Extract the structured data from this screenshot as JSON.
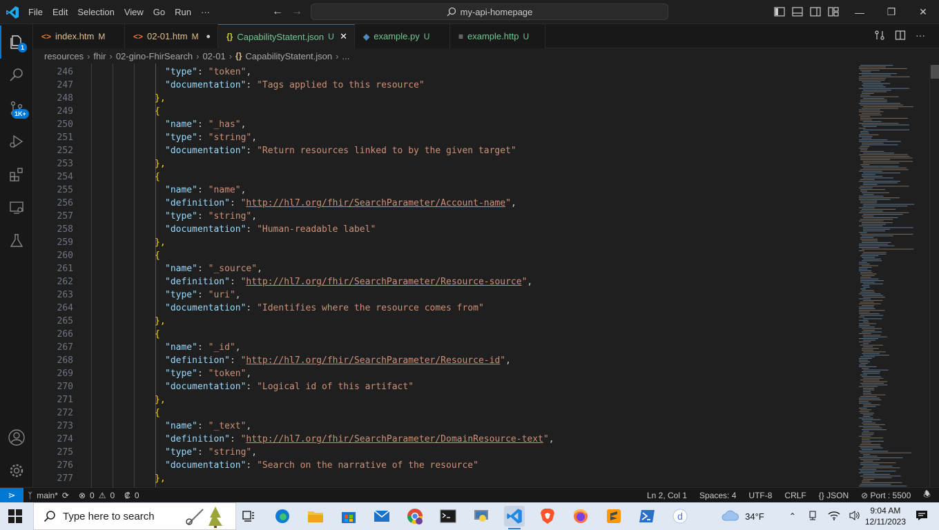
{
  "menu": [
    "File",
    "Edit",
    "Selection",
    "View",
    "Go",
    "Run",
    "···"
  ],
  "command_center": "my-api-homepage",
  "window_controls": {
    "minimize": "—",
    "restore": "❐",
    "close": "✕"
  },
  "activity_badges": {
    "accounts_badge": "1",
    "source_control_badge": "1K+"
  },
  "tabs": [
    {
      "label": "index.htm",
      "status": "M",
      "icon": "<>",
      "icon_color": "#e37933",
      "label_color": "#e2c08d",
      "status_color": "#e2c08d"
    },
    {
      "label": "02-01.htm",
      "status": "M",
      "icon": "<>",
      "icon_color": "#e37933",
      "label_color": "#e2c08d",
      "status_color": "#e2c08d",
      "dirty": "●"
    },
    {
      "label": "CapabilityStatent.json",
      "status": "U",
      "icon": "{}",
      "icon_color": "#cbcb41",
      "label_color": "#73c991",
      "status_color": "#73c991",
      "close": "✕"
    },
    {
      "label": "example.py",
      "status": "U",
      "icon": "◆",
      "icon_color": "#4b8bbe",
      "label_color": "#73c991",
      "status_color": "#73c991"
    },
    {
      "label": "example.http",
      "status": "U",
      "icon": "≡",
      "icon_color": "#cccccc",
      "label_color": "#73c991",
      "status_color": "#73c991"
    }
  ],
  "breadcrumb": [
    "resources",
    "fhir",
    "02-gino-FhirSearch",
    "02-01",
    "CapabilityStatent.json",
    "..."
  ],
  "breadcrumb_file_icon": "{}",
  "editor": {
    "lines": [
      {
        "num": "246",
        "key": "type",
        "val": "token",
        "comma": true
      },
      {
        "num": "247",
        "key": "documentation",
        "val": "Tags applied to this resource",
        "comma": false
      },
      {
        "num": "248",
        "punct": "},"
      },
      {
        "num": "249",
        "punct": "{"
      },
      {
        "num": "250",
        "key": "name",
        "val": "_has",
        "comma": true
      },
      {
        "num": "251",
        "key": "type",
        "val": "string",
        "comma": true
      },
      {
        "num": "252",
        "key": "documentation",
        "val": "Return resources linked to by the given target",
        "comma": false
      },
      {
        "num": "253",
        "punct": "},"
      },
      {
        "num": "254",
        "punct": "{"
      },
      {
        "num": "255",
        "key": "name",
        "val": "name",
        "comma": true
      },
      {
        "num": "256",
        "key": "definition",
        "val": "http://hl7.org/fhir/SearchParameter/Account-name",
        "comma": true,
        "link": true
      },
      {
        "num": "257",
        "key": "type",
        "val": "string",
        "comma": true
      },
      {
        "num": "258",
        "key": "documentation",
        "val": "Human-readable label",
        "comma": false
      },
      {
        "num": "259",
        "punct": "},"
      },
      {
        "num": "260",
        "punct": "{"
      },
      {
        "num": "261",
        "key": "name",
        "val": "_source",
        "comma": true
      },
      {
        "num": "262",
        "key": "definition",
        "val": "http://hl7.org/fhir/SearchParameter/Resource-source",
        "comma": true,
        "link": true
      },
      {
        "num": "263",
        "key": "type",
        "val": "uri",
        "comma": true
      },
      {
        "num": "264",
        "key": "documentation",
        "val": "Identifies where the resource comes from",
        "comma": false
      },
      {
        "num": "265",
        "punct": "},"
      },
      {
        "num": "266",
        "punct": "{"
      },
      {
        "num": "267",
        "key": "name",
        "val": "_id",
        "comma": true
      },
      {
        "num": "268",
        "key": "definition",
        "val": "http://hl7.org/fhir/SearchParameter/Resource-id",
        "comma": true,
        "link": true
      },
      {
        "num": "269",
        "key": "type",
        "val": "token",
        "comma": true
      },
      {
        "num": "270",
        "key": "documentation",
        "val": "Logical id of this artifact",
        "comma": false
      },
      {
        "num": "271",
        "punct": "},"
      },
      {
        "num": "272",
        "punct": "{"
      },
      {
        "num": "273",
        "key": "name",
        "val": "_text",
        "comma": true
      },
      {
        "num": "274",
        "key": "definition",
        "val": "http://hl7.org/fhir/SearchParameter/DomainResource-text",
        "comma": true,
        "link": true
      },
      {
        "num": "275",
        "key": "type",
        "val": "string",
        "comma": true
      },
      {
        "num": "276",
        "key": "documentation",
        "val": "Search on the narrative of the resource",
        "comma": false
      },
      {
        "num": "277",
        "punct": "},"
      }
    ]
  },
  "statusbar": {
    "branch": "main*",
    "errors": "0",
    "warnings": "0",
    "ports_forwarded": "0",
    "cursor": "Ln 2, Col 1",
    "spaces": "Spaces: 4",
    "encoding": "UTF-8",
    "eol": "CRLF",
    "language": "JSON",
    "port": "Port : 5500"
  },
  "taskbar": {
    "search_placeholder": "Type here to search",
    "weather": "34°F",
    "time": "9:04 AM",
    "date": "12/11/2023"
  }
}
